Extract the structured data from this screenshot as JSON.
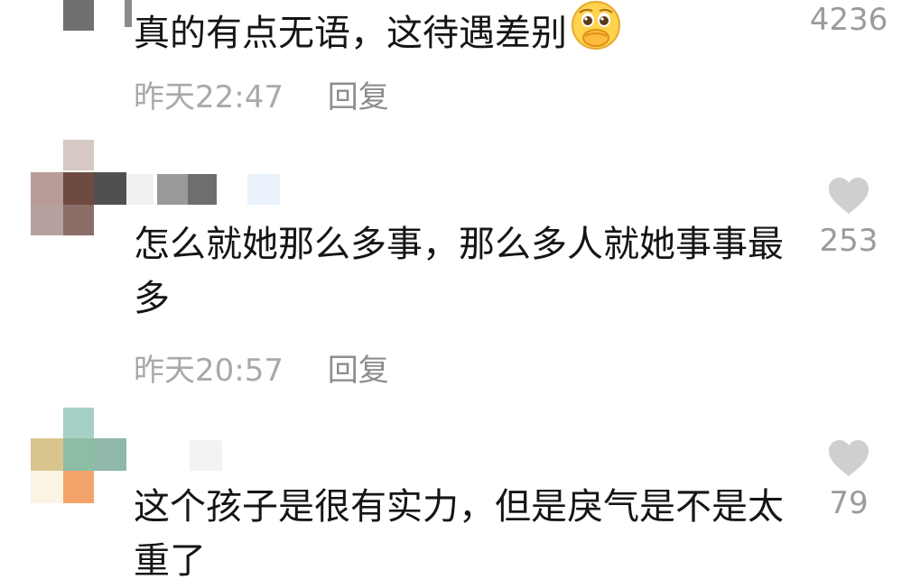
{
  "comments": [
    {
      "text": "真的有点无语，这待遇差别",
      "time": "昨天22:47",
      "reply": "回复",
      "likes": "4236",
      "emoji": "pleading-face-emoji"
    },
    {
      "text": "怎么就她那么多事，那么多人就她事事最多",
      "time": "昨天20:57",
      "reply": "回复",
      "likes": "253"
    },
    {
      "text": "这个孩子是很有实力，但是戾气是不是太重了",
      "likes": "79"
    }
  ],
  "icons": {
    "like": "heart-icon"
  },
  "colors": {
    "heart": "#cfcfcf",
    "meta": "#a9a9a9",
    "text": "#151515"
  }
}
